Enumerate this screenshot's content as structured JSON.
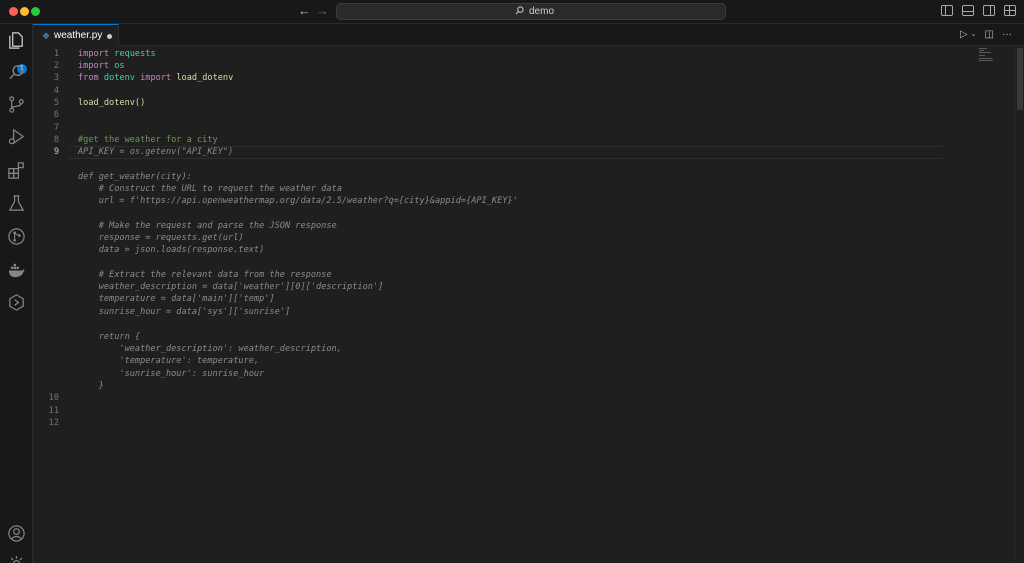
{
  "window": {
    "search_text": "demo",
    "icons": [
      "back-arrow-icon",
      "forward-arrow-icon",
      "search-icon",
      "toggle-primary-sidebar-icon",
      "toggle-panel-icon",
      "toggle-secondary-sidebar-icon",
      "customize-layout-icon"
    ]
  },
  "activity_bar": {
    "items": [
      "explorer-icon",
      "search-icon",
      "source-control-icon",
      "run-debug-icon",
      "extensions-icon",
      "testing-icon",
      "git-graph-icon",
      "docker-icon",
      "remote-explorer-icon",
      "account-icon",
      "settings-gear-icon"
    ],
    "explorer_badge": "1"
  },
  "tab": {
    "label": "weather.py",
    "icon": "python-file-icon",
    "unsaved": true,
    "actions": [
      "run-icon",
      "chevron-down-icon",
      "split-editor-icon",
      "more-actions-icon"
    ]
  },
  "editor": {
    "active_line": 9,
    "line_numbers": [
      "1",
      "2",
      "3",
      "4",
      "5",
      "6",
      "7",
      "8",
      "9",
      "10",
      "11",
      "12"
    ],
    "lines": {
      "l1_kw": "import",
      "l1_mod": "requests",
      "l2_kw": "import",
      "l2_mod": "os",
      "l3_kw1": "from",
      "l3_mod": "dotenv",
      "l3_kw2": "import",
      "l3_fn": "load_dotenv",
      "l5": "load_dotenv()",
      "l8": "#get the weather for a city",
      "l9": "API_KEY = os.getenv(\"API_KEY\")",
      "g1": "def get_weather(city):",
      "g2": "    # Construct the URL to request the weather data",
      "g3": "    url = f'https://api.openweathermap.org/data/2.5/weather?q={city}&appid={API_KEY}'",
      "g4": "    # Make the request and parse the JSON response",
      "g5": "    response = requests.get(url)",
      "g6": "    data = json.loads(response.text)",
      "g7": "    # Extract the relevant data from the response",
      "g8": "    weather_description = data['weather'][0]['description']",
      "g9": "    temperature = data['main']['temp']",
      "g10": "    sunrise_hour = data['sys']['sunrise']",
      "g11": "    return {",
      "g12": "        'weather_description': weather_description,",
      "g13": "        'temperature': temperature,",
      "g14": "        'sunrise_hour': sunrise_hour",
      "g15": "    }"
    }
  }
}
